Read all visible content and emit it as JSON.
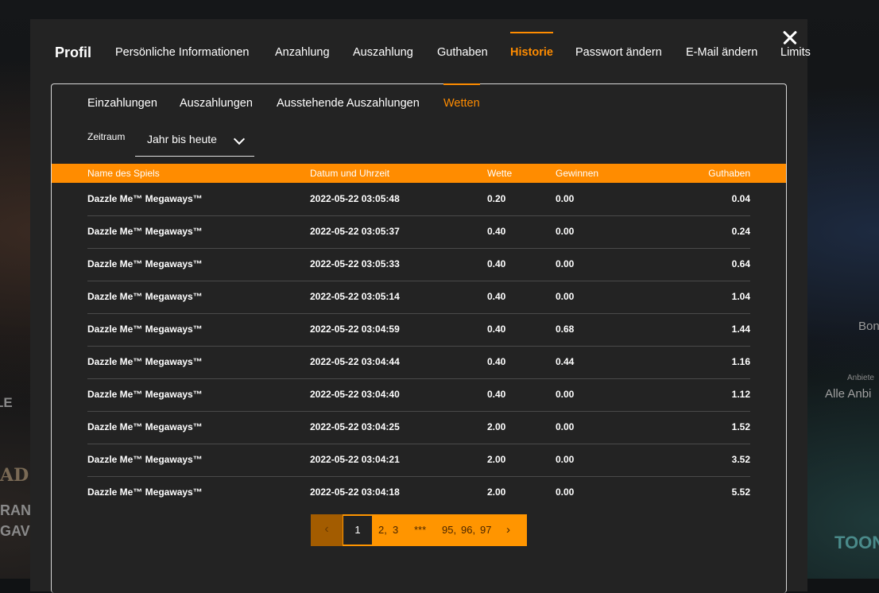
{
  "background": {
    "left_texts": [
      "LE",
      "AD",
      "RAN",
      "GAV"
    ],
    "right_texts": [
      "Bon",
      "Anbiete",
      "Alle Anbi",
      "TOONZ"
    ]
  },
  "nav": {
    "title": "Profil",
    "tabs": [
      {
        "label": "Persönliche Informationen"
      },
      {
        "label": "Anzahlung"
      },
      {
        "label": "Auszahlung"
      },
      {
        "label": "Guthaben"
      },
      {
        "label": "Historie",
        "active": true
      },
      {
        "label": "Passwort ändern"
      },
      {
        "label": "E-Mail ändern"
      },
      {
        "label": "Limits"
      }
    ]
  },
  "subtabs": [
    {
      "label": "Einzahlungen"
    },
    {
      "label": "Auszahlungen"
    },
    {
      "label": "Ausstehende Auszahlungen"
    },
    {
      "label": "Wetten",
      "active": true
    }
  ],
  "filter": {
    "label": "Zeitraum",
    "selected": "Jahr bis heute"
  },
  "table": {
    "headers": [
      "Name des Spiels",
      "Datum und Uhrzeit",
      "Wette",
      "Gewinnen",
      "Guthaben"
    ],
    "rows": [
      [
        "Dazzle Me™ Megaways™",
        "2022-05-22 03:05:48",
        "0.20",
        "0.00",
        "0.04"
      ],
      [
        "Dazzle Me™ Megaways™",
        "2022-05-22 03:05:37",
        "0.40",
        "0.00",
        "0.24"
      ],
      [
        "Dazzle Me™ Megaways™",
        "2022-05-22 03:05:33",
        "0.40",
        "0.00",
        "0.64"
      ],
      [
        "Dazzle Me™ Megaways™",
        "2022-05-22 03:05:14",
        "0.40",
        "0.00",
        "1.04"
      ],
      [
        "Dazzle Me™ Megaways™",
        "2022-05-22 03:04:59",
        "0.40",
        "0.68",
        "1.44"
      ],
      [
        "Dazzle Me™ Megaways™",
        "2022-05-22 03:04:44",
        "0.40",
        "0.44",
        "1.16"
      ],
      [
        "Dazzle Me™ Megaways™",
        "2022-05-22 03:04:40",
        "0.40",
        "0.00",
        "1.12"
      ],
      [
        "Dazzle Me™ Megaways™",
        "2022-05-22 03:04:25",
        "2.00",
        "0.00",
        "1.52"
      ],
      [
        "Dazzle Me™ Megaways™",
        "2022-05-22 03:04:21",
        "2.00",
        "0.00",
        "3.52"
      ],
      [
        "Dazzle Me™ Megaways™",
        "2022-05-22 03:04:18",
        "2.00",
        "0.00",
        "5.52"
      ]
    ]
  },
  "pagination": {
    "prev": "‹",
    "current": "1",
    "items": [
      "2,",
      "3",
      "***",
      "95,",
      "96,",
      "97"
    ],
    "next": "›"
  },
  "colors": {
    "accent": "#ff8c00",
    "modal_bg": "#232323"
  }
}
